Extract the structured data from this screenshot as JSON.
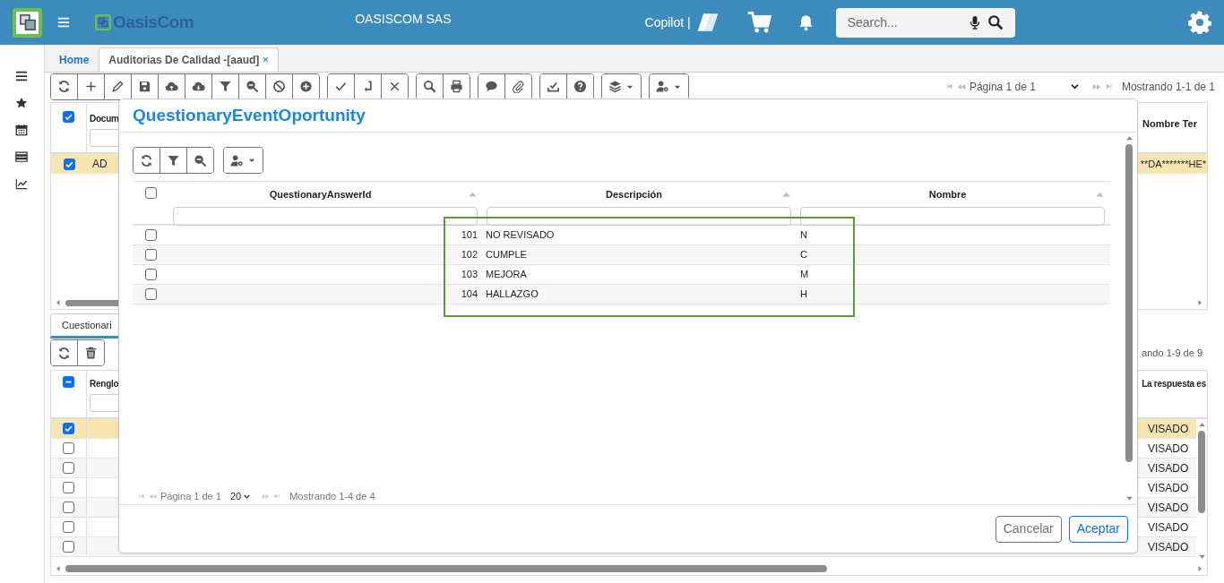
{
  "app_bar": {
    "logo_text": "OasisCom",
    "company": "OASISCOM SAS",
    "copilot_label": "Copilot |",
    "search": {
      "placeholder": "Search..."
    }
  },
  "tabs": [
    {
      "label": "Home",
      "selected": false
    },
    {
      "label": "Auditorias De Calidad -[aaud]",
      "selected": true,
      "close": "×"
    }
  ],
  "main_pager": {
    "page": "Página 1 de 1",
    "showing": "Mostrando 1-1 de 1"
  },
  "upper_grid": {
    "header_checked": true,
    "columns": [
      "Docum",
      "Nombre Ter"
    ],
    "rows": [
      {
        "selected": true,
        "cells": [
          "AD",
          "**DA*******HE*"
        ]
      }
    ]
  },
  "detail_tab": {
    "label": "Cuestionari"
  },
  "lower_pager": {
    "showing": "ando 1-9 de 9"
  },
  "lower_grid": {
    "header_checkbox": {
      "indeterminate": true
    },
    "columns": [
      "Renglo",
      "La respuesta es"
    ],
    "rows": [
      {
        "selected": true,
        "answer": "VISADO"
      },
      {
        "selected": false,
        "answer": "VISADO"
      },
      {
        "selected": false,
        "answer": "VISADO"
      },
      {
        "selected": false,
        "answer": "VISADO"
      },
      {
        "selected": false,
        "answer": "VISADO"
      },
      {
        "selected": false,
        "answer": "VISADO"
      },
      {
        "selected": false,
        "answer": "VISADO"
      }
    ]
  },
  "dialog": {
    "title": "QuestionaryEventOportunity",
    "header_checked": false,
    "columns": [
      "QuestionaryAnswerId",
      "Descripción",
      "Nombre"
    ],
    "rows": [
      {
        "checked": false,
        "id": "101",
        "description": "NO REVISADO",
        "name": "N"
      },
      {
        "checked": false,
        "id": "102",
        "description": "CUMPLE",
        "name": "C"
      },
      {
        "checked": false,
        "id": "103",
        "description": "MEJORA",
        "name": "M"
      },
      {
        "checked": false,
        "id": "104",
        "description": "HALLAZGO",
        "name": "H"
      }
    ],
    "pager": {
      "page": "Página 1 de 1",
      "page_size": "20",
      "showing": "Mostrando 1-4 de 4"
    },
    "buttons": [
      {
        "label": "Cancelar",
        "kind": "secondary"
      },
      {
        "label": "Aceptar",
        "kind": "primary"
      }
    ]
  }
}
